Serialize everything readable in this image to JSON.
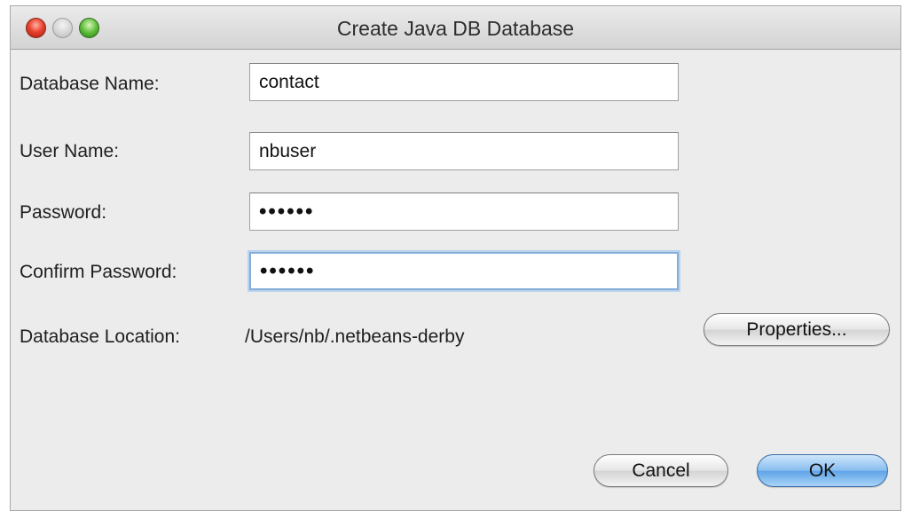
{
  "window": {
    "title": "Create Java DB Database"
  },
  "title_buttons": {
    "close_icon": "close-icon",
    "minimize_icon": "minimize-icon",
    "zoom_icon": "zoom-icon"
  },
  "form": {
    "database_name_label": "Database Name:",
    "database_name_value": "contact",
    "user_name_label": "User Name:",
    "user_name_value": "nbuser",
    "password_label": "Password:",
    "password_value": "••••••",
    "confirm_password_label": "Confirm Password:",
    "confirm_password_value": "••••••",
    "database_location_label": "Database Location:",
    "database_location_value": "/Users/nb/.netbeans-derby"
  },
  "buttons": {
    "properties_label": "Properties...",
    "cancel_label": "Cancel",
    "ok_label": "OK"
  },
  "colors": {
    "window_bg": "#ececec",
    "focus_ring": "#86aed8",
    "default_button": "#5ea3e7"
  }
}
